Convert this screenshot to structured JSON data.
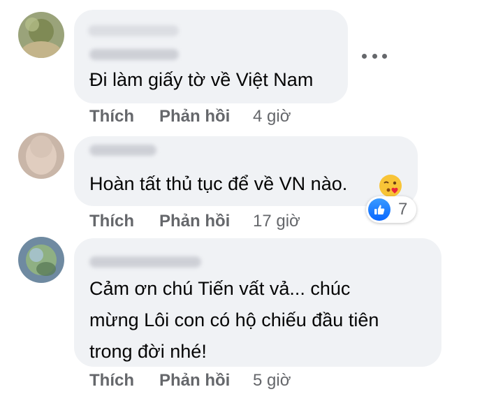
{
  "comments": [
    {
      "text_lines": [
        "Đi làm giấy tờ về Việt Nam"
      ],
      "like_label": "Thích",
      "reply_label": "Phản hồi",
      "time": "4 giờ"
    },
    {
      "text_lines": [
        "Hoàn tất thủ tục để về VN nào."
      ],
      "like_label": "Thích",
      "reply_label": "Phản hồi",
      "time": "17 giờ",
      "reaction_count": "7"
    },
    {
      "text_lines": [
        "Cảm ơn chú Tiến vất vả... chúc",
        "mừng Lôi con có hộ chiếu đầu tiên",
        "trong đời nhé!"
      ],
      "like_label": "Thích",
      "reply_label": "Phản hồi",
      "time": "5 giờ"
    }
  ],
  "icons": {
    "more": "more-options-icon",
    "reaction": "like-reaction-icon",
    "emoji": "blowing-kiss-emoji"
  },
  "colors": {
    "bubble": "#f0f2f5",
    "text": "#050505",
    "secondary": "#65676b",
    "like_blue": "#0866ff"
  }
}
